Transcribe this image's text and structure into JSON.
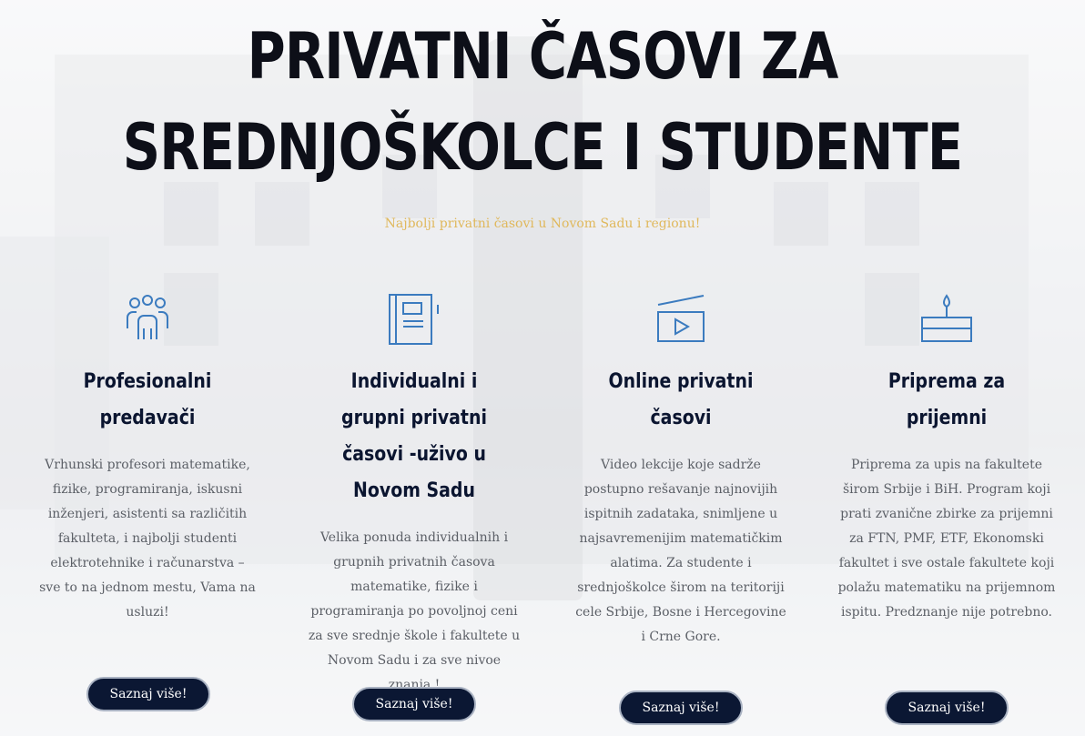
{
  "hero": {
    "title": "PRIVATNI ČASOVI ZA SREDNJOŠKOLCE I STUDENTE",
    "subtitle": "Najbolji privatni časovi u Novom Sadu i regionu!"
  },
  "features": [
    {
      "icon": "people-group-icon",
      "title": "Profesionalni predavači",
      "text": "Vrhunski profesori matematike, fizike, programiranja, iskusni inženjeri, asistenti sa različitih fakulteta, i najbolji studenti elektrotehnike i računarstva – sve to na jednom mestu, Vama na usluzi!",
      "button": "Saznaj više!"
    },
    {
      "icon": "notebook-icon",
      "title": "Individualni i grupni privatni časovi -uživo u Novom Sadu",
      "text": "Velika ponuda individualnih i grupnih privatnih časova matematike, fizike i programiranja po povoljnoj ceni za sve srednje škole i fakultete u Novom Sadu i za sve nivoe znanja !",
      "button": "Saznaj više!"
    },
    {
      "icon": "video-play-icon",
      "title": "Online privatni časovi",
      "text": "Video lekcije koje sadrže postupno rešavanje najnovijih ispitnih zadataka, snimljene u najsavremenijim matematičkim alatima. Za studente i srednjoškolce širom na teritoriji cele Srbije, Bosne i Hercegovine i Crne Gore.",
      "button": "Saznaj više!"
    },
    {
      "icon": "candle-cake-icon",
      "title": "Priprema za prijemni",
      "text": "Priprema za upis na  fakultete širom Srbije i BiH.  Program koji prati zvanične zbirke za prijemni za FTN, PMF, ETF, Ekonomski fakultet i sve ostale fakultete koji polažu matematiku na prijemnom ispitu. Predznanje nije potrebno.",
      "button": "Saznaj više!"
    }
  ],
  "colors": {
    "title": "#0d0f18",
    "subtitle": "#e0b85c",
    "heading": "#0b1530",
    "icon": "#3b7bbf",
    "button_bg": "#0b1733"
  }
}
